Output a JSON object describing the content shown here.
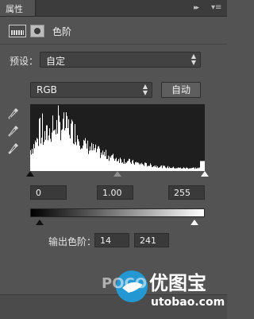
{
  "panel": {
    "tab_label": "属性",
    "subtitle": "色阶",
    "collapse_glyph": "▸▸",
    "menu_glyph": "▾≡"
  },
  "preset": {
    "label": "预设：",
    "value": "自定"
  },
  "channel": {
    "value": "RGB",
    "auto_label": "自动"
  },
  "input_levels": {
    "black": "0",
    "gamma": "1.00",
    "white": "255"
  },
  "output_levels": {
    "label": "输出色阶：",
    "black": "14",
    "white": "241"
  },
  "histogram": {
    "range": [
      0,
      255
    ],
    "color": "#ffffff",
    "background": "#ffffff"
  },
  "watermark": {
    "brand_left": "POCO",
    "brand_right": "优图宝",
    "url": "utobao.com"
  },
  "colors": {
    "panel_bg": "#535353",
    "titlebar_bg": "#3c3c3c",
    "field_bg": "#3a3a3a",
    "text": "#e6e6e6",
    "watermark_blue": "#1ea0e0"
  },
  "icons": {
    "adjustment": "levels-adjustment-icon",
    "mask": "layer-mask-icon",
    "eyedroppers": [
      "black-eyedropper-icon",
      "gray-eyedropper-icon",
      "white-eyedropper-icon"
    ]
  }
}
